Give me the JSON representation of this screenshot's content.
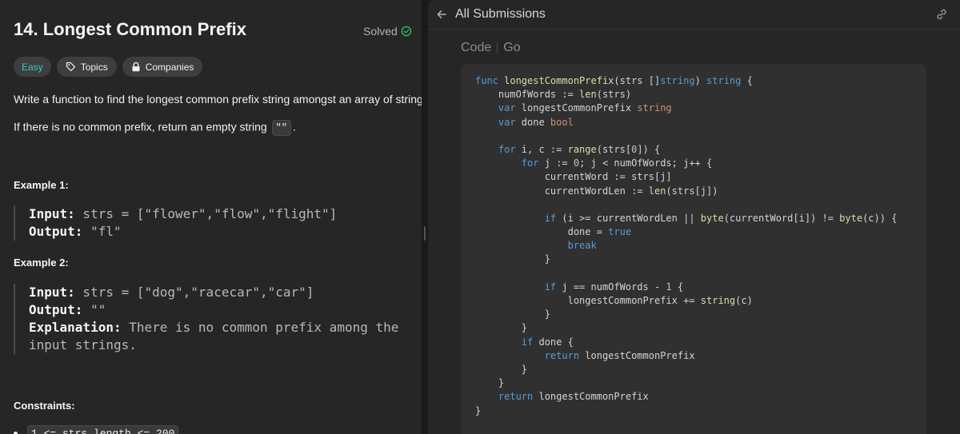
{
  "problem": {
    "title": "14. Longest Common Prefix",
    "status": "Solved",
    "tags": {
      "difficulty": "Easy",
      "topics": "Topics",
      "companies": "Companies"
    },
    "description_1": "Write a function to find the longest common prefix string amongst an array of strings.",
    "description_2_text": "If there is no common prefix, return an empty string",
    "description_2_code": "\"\"",
    "description_2_end": ".",
    "example1": {
      "label": "Example 1:",
      "input_key": "Input:",
      "input_val": " strs = [\"flower\",\"flow\",\"flight\"]",
      "output_key": "Output:",
      "output_val": " \"fl\""
    },
    "example2": {
      "label": "Example 2:",
      "input_key": "Input:",
      "input_val": " strs = [\"dog\",\"racecar\",\"car\"]",
      "output_key": "Output:",
      "output_val": " \"\"",
      "explanation_key": "Explanation:",
      "explanation_val_1": " There is no common prefix among the",
      "explanation_val_2": "input strings."
    },
    "constraints_label": "Constraints:",
    "constraint_1": "1 <= strs.length <= 200"
  },
  "submission": {
    "header_title": "All Submissions",
    "tab_code": "Code",
    "language": "Go",
    "code_lines": [
      [
        [
          "kw",
          "func "
        ],
        [
          "fn",
          "longestCommonPrefix"
        ],
        [
          "plain",
          "(strs []"
        ],
        [
          "kw",
          "string"
        ],
        [
          "plain",
          ") "
        ],
        [
          "kw",
          "string"
        ],
        [
          "plain",
          " {"
        ]
      ],
      [
        [
          "plain",
          "    numOfWords := "
        ],
        [
          "fn",
          "len"
        ],
        [
          "plain",
          "(strs)"
        ]
      ],
      [
        [
          "kw",
          "    var "
        ],
        [
          "plain",
          "longestCommonPrefix "
        ],
        [
          "type",
          "string"
        ]
      ],
      [
        [
          "kw",
          "    var "
        ],
        [
          "plain",
          "done "
        ],
        [
          "type",
          "bool"
        ]
      ],
      [],
      [
        [
          "kw",
          "    for "
        ],
        [
          "plain",
          "i, c := "
        ],
        [
          "fn",
          "range"
        ],
        [
          "plain",
          "(strs["
        ],
        [
          "num",
          "0"
        ],
        [
          "plain",
          "]) {"
        ]
      ],
      [
        [
          "kw",
          "        for "
        ],
        [
          "plain",
          "j := "
        ],
        [
          "num",
          "0"
        ],
        [
          "plain",
          "; j < numOfWords; j++ {"
        ]
      ],
      [
        [
          "plain",
          "            currentWord := strs[j]"
        ]
      ],
      [
        [
          "plain",
          "            currentWordLen := "
        ],
        [
          "fn",
          "len"
        ],
        [
          "plain",
          "(strs[j])"
        ]
      ],
      [],
      [
        [
          "kw",
          "            if "
        ],
        [
          "plain",
          "(i >= currentWordLen || "
        ],
        [
          "fn",
          "byte"
        ],
        [
          "plain",
          "(currentWord[i]) != "
        ],
        [
          "fn",
          "byte"
        ],
        [
          "plain",
          "(c)) {"
        ]
      ],
      [
        [
          "plain",
          "                done = "
        ],
        [
          "kw",
          "true"
        ]
      ],
      [
        [
          "kw",
          "                break"
        ]
      ],
      [
        [
          "plain",
          "            }"
        ]
      ],
      [],
      [
        [
          "kw",
          "            if "
        ],
        [
          "plain",
          "j == numOfWords - "
        ],
        [
          "num",
          "1"
        ],
        [
          "plain",
          " {"
        ]
      ],
      [
        [
          "plain",
          "                longestCommonPrefix += "
        ],
        [
          "fn",
          "string"
        ],
        [
          "plain",
          "(c)"
        ]
      ],
      [
        [
          "plain",
          "            }"
        ]
      ],
      [
        [
          "plain",
          "        }"
        ]
      ],
      [
        [
          "kw",
          "        if "
        ],
        [
          "plain",
          "done {"
        ]
      ],
      [
        [
          "kw",
          "            return "
        ],
        [
          "plain",
          "longestCommonPrefix"
        ]
      ],
      [
        [
          "plain",
          "        }"
        ]
      ],
      [
        [
          "plain",
          "    }"
        ]
      ],
      [
        [
          "kw",
          "    return "
        ],
        [
          "plain",
          "longestCommonPrefix"
        ]
      ],
      [
        [
          "plain",
          "}"
        ]
      ]
    ]
  },
  "colors": {
    "easy": "#46c6c2",
    "solved_check": "#2cbb5d",
    "keyword": "#569cd6",
    "function": "#dcdcaa",
    "type": "#ce9178",
    "number": "#b5cea8"
  },
  "icons": {
    "solved": "check-circle-icon",
    "topics": "tag-icon",
    "companies": "lock-icon",
    "back": "arrow-left-icon",
    "link": "link-icon"
  }
}
